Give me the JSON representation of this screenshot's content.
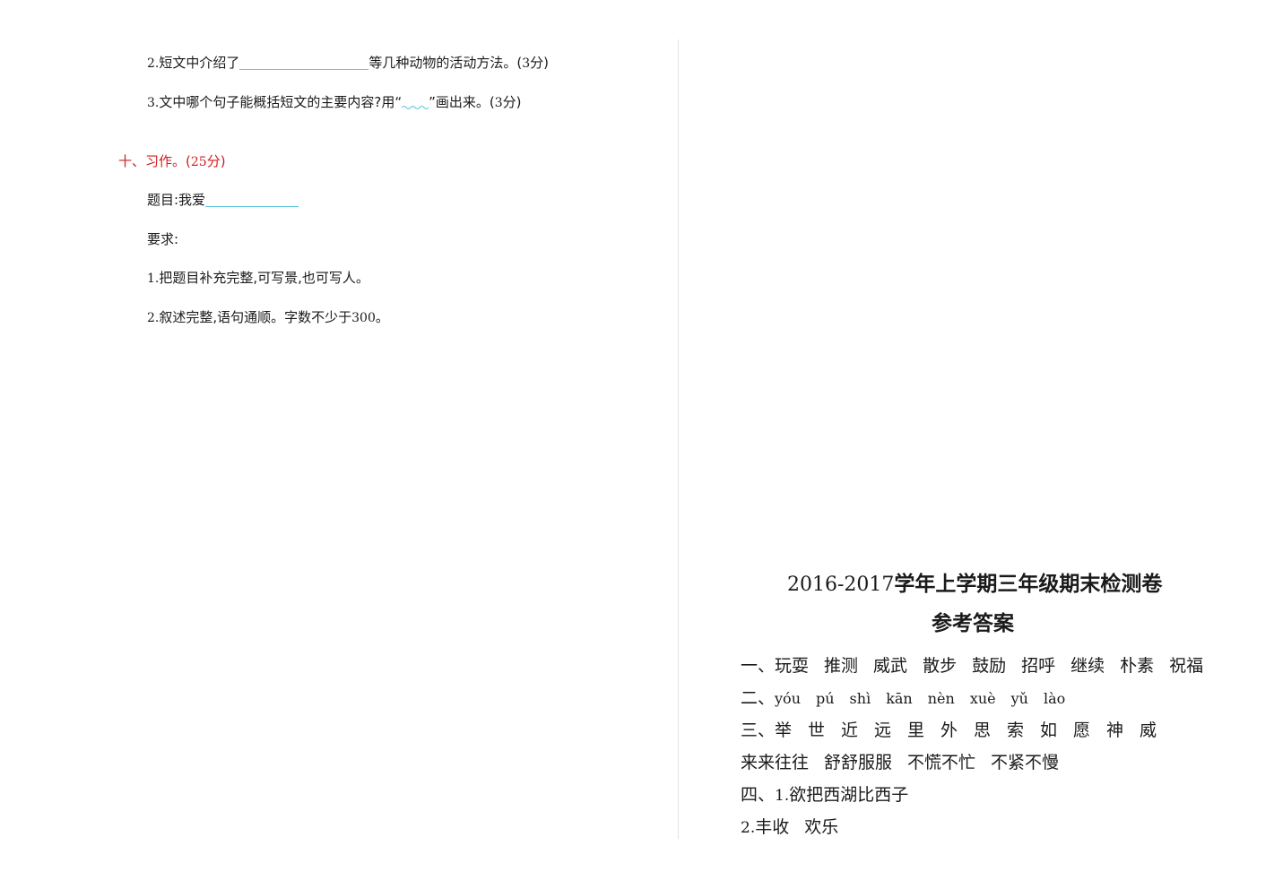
{
  "left": {
    "q2": {
      "num": "2.",
      "text_before": "短文中介绍了",
      "text_after": "等几种动物的活动方法。(",
      "score": "3",
      "score_unit": "分)"
    },
    "q3": {
      "num": "3.",
      "text_before": "文中哪个句子能概括短文的主要内容?用“",
      "text_after": "”画出来。(",
      "score": "3",
      "score_unit": "分)"
    },
    "section10": {
      "label": "十、习作。(",
      "score": "25",
      "score_unit": "分)"
    },
    "topic": {
      "text": "题目:我爱"
    },
    "requirements": {
      "label": "要求:",
      "item1_num": "1.",
      "item1": "把题目补充完整,可写景,也可写人。",
      "item2_num": "2.",
      "item2_text": "叙述完整,语句通顺。字数不少于",
      "item2_count": "300",
      "item2_end": "。"
    }
  },
  "right": {
    "title_years": "2016-2017",
    "title_rest": "学年上学期三年级期末检测卷",
    "subtitle": "参考答案",
    "ans1": {
      "label": "一、",
      "words": [
        "玩耍",
        "推测",
        "威武",
        "散步",
        "鼓励",
        "招呼",
        "继续",
        "朴素",
        "祝福"
      ]
    },
    "ans2": {
      "label": "二、",
      "pinyin": [
        "yóu",
        "pú",
        "shì",
        "kān",
        "nèn",
        "xuè",
        "yǔ",
        "lào"
      ]
    },
    "ans3": {
      "label": "三、",
      "chars": [
        "举",
        "世",
        "近",
        "远",
        "里",
        "外",
        "思",
        "索",
        "如",
        "愿",
        "神",
        "威"
      ],
      "line2": [
        "来来往往",
        "舒舒服服",
        "不慌不忙",
        "不紧不慢"
      ]
    },
    "ans4": {
      "label": "四、",
      "item1_num": "1.",
      "item1": "欲把西湖比西子",
      "item2_num": "2.",
      "item2": [
        "丰收",
        "欢乐"
      ]
    }
  }
}
